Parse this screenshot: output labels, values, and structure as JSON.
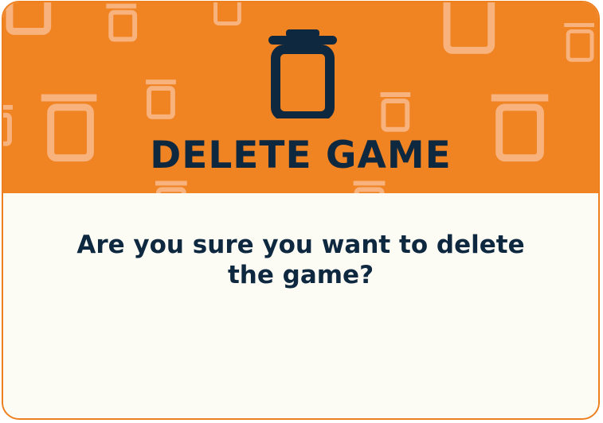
{
  "dialog": {
    "title": "DELETE GAME",
    "message": "Are you sure you want to delete the game?",
    "icon": "trash-icon"
  },
  "colors": {
    "header": "#f08322",
    "body": "#fcfcf4",
    "text": "#0e2840",
    "border": "#ee7f1f"
  }
}
